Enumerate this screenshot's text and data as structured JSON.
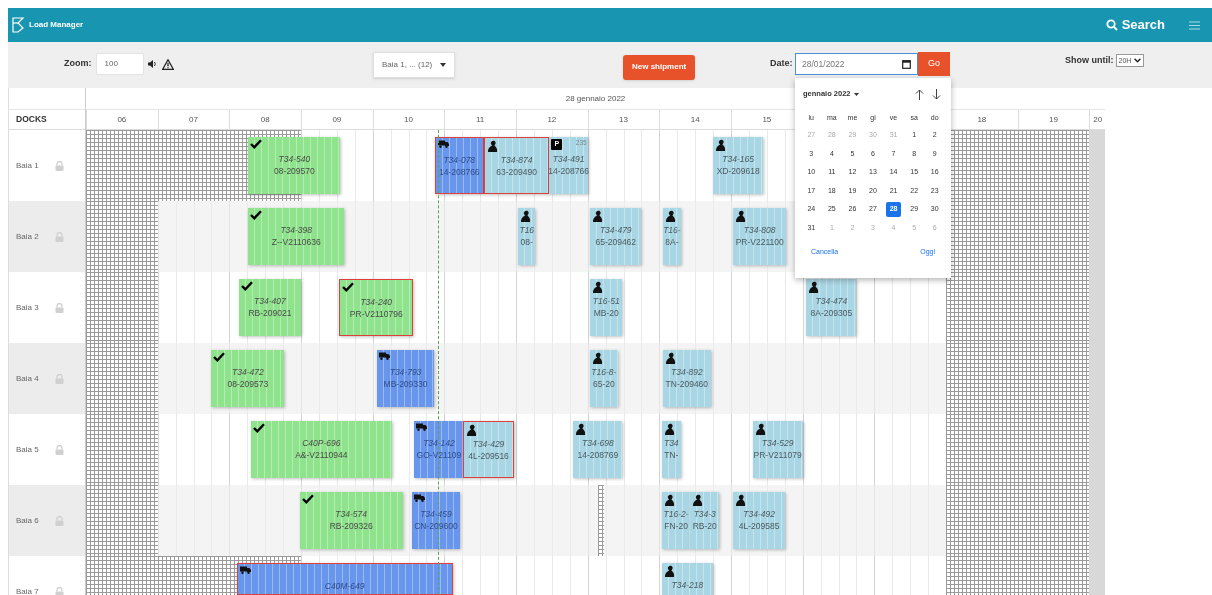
{
  "app": {
    "title": "Load Manager",
    "search": "Search"
  },
  "toolbar": {
    "zoom_label": "Zoom:",
    "zoom_value": "100",
    "dock_filter": "Baia 1, ... (12)",
    "new_shipment": "New shipment",
    "date_label": "Date:",
    "date_value": "28/01/2022",
    "go": "Go",
    "show_until_label": "Show until:",
    "show_until_value": "20H"
  },
  "calendar": {
    "month": "gennaio 2022",
    "weekdays": [
      "lu",
      "ma",
      "me",
      "gi",
      "ve",
      "sa",
      "do"
    ],
    "weeks": [
      [
        {
          "day": "27",
          "outside": true,
          "selected": false
        },
        {
          "day": "28",
          "outside": true,
          "selected": false
        },
        {
          "day": "29",
          "outside": true,
          "selected": false
        },
        {
          "day": "30",
          "outside": true,
          "selected": false
        },
        {
          "day": "31",
          "outside": true,
          "selected": false
        },
        {
          "day": "1",
          "outside": false,
          "selected": false
        },
        {
          "day": "2",
          "outside": false,
          "selected": false
        }
      ],
      [
        {
          "day": "3",
          "outside": false,
          "selected": false
        },
        {
          "day": "4",
          "outside": false,
          "selected": false
        },
        {
          "day": "5",
          "outside": false,
          "selected": false
        },
        {
          "day": "6",
          "outside": false,
          "selected": false
        },
        {
          "day": "7",
          "outside": false,
          "selected": false
        },
        {
          "day": "8",
          "outside": false,
          "selected": false
        },
        {
          "day": "9",
          "outside": false,
          "selected": false
        }
      ],
      [
        {
          "day": "10",
          "outside": false,
          "selected": false
        },
        {
          "day": "11",
          "outside": false,
          "selected": false
        },
        {
          "day": "12",
          "outside": false,
          "selected": false
        },
        {
          "day": "13",
          "outside": false,
          "selected": false
        },
        {
          "day": "14",
          "outside": false,
          "selected": false
        },
        {
          "day": "15",
          "outside": false,
          "selected": false
        },
        {
          "day": "16",
          "outside": false,
          "selected": false
        }
      ],
      [
        {
          "day": "17",
          "outside": false,
          "selected": false
        },
        {
          "day": "18",
          "outside": false,
          "selected": false
        },
        {
          "day": "19",
          "outside": false,
          "selected": false
        },
        {
          "day": "20",
          "outside": false,
          "selected": false
        },
        {
          "day": "21",
          "outside": false,
          "selected": false
        },
        {
          "day": "22",
          "outside": false,
          "selected": false
        },
        {
          "day": "23",
          "outside": false,
          "selected": false
        }
      ],
      [
        {
          "day": "24",
          "outside": false,
          "selected": false
        },
        {
          "day": "25",
          "outside": false,
          "selected": false
        },
        {
          "day": "26",
          "outside": false,
          "selected": false
        },
        {
          "day": "27",
          "outside": false,
          "selected": false
        },
        {
          "day": "28",
          "outside": false,
          "selected": true
        },
        {
          "day": "29",
          "outside": false,
          "selected": false
        },
        {
          "day": "30",
          "outside": false,
          "selected": false
        }
      ],
      [
        {
          "day": "31",
          "outside": false,
          "selected": false
        },
        {
          "day": "1",
          "outside": true,
          "selected": false
        },
        {
          "day": "2",
          "outside": true,
          "selected": false
        },
        {
          "day": "3",
          "outside": true,
          "selected": false
        },
        {
          "day": "4",
          "outside": true,
          "selected": false
        },
        {
          "day": "5",
          "outside": true,
          "selected": false
        },
        {
          "day": "6",
          "outside": true,
          "selected": false
        }
      ]
    ],
    "clear": "Cancella",
    "today": "Oggi"
  },
  "schedule": {
    "date": "28 gennaio 2022",
    "docks_label": "DOCKS",
    "hours": [
      "06",
      "07",
      "08",
      "09",
      "10",
      "11",
      "12",
      "13",
      "14",
      "15",
      "18",
      "19",
      "20"
    ],
    "docks": [
      {
        "name": "Baia 1",
        "shipments": [
          {
            "kind": "done",
            "late": false,
            "title": "T34-540",
            "code": "08-209570"
          },
          {
            "kind": "truck",
            "late": true,
            "title": "T34-078",
            "code": "14-208766"
          },
          {
            "kind": "sea",
            "late": true,
            "title": "T34-874",
            "code": "63-209490"
          },
          {
            "kind": "parked",
            "late": false,
            "title": "T34-491",
            "code": "14-208766",
            "badge": "P",
            "note": "235"
          },
          {
            "kind": "sea",
            "late": false,
            "title": "T34-165",
            "code": "XD-209618"
          }
        ]
      },
      {
        "name": "Baia 2",
        "shipments": [
          {
            "kind": "done",
            "late": false,
            "title": "T34-398",
            "code": "Z--V2110636"
          },
          {
            "kind": "sea",
            "late": false,
            "title": "T16",
            "code": "08-"
          },
          {
            "kind": "sea",
            "late": false,
            "title": "T34-479",
            "code": "65-209462"
          },
          {
            "kind": "sea",
            "late": false,
            "title": "T16-",
            "code": "8A-"
          },
          {
            "kind": "sea",
            "late": false,
            "title": "T34-808",
            "code": "PR-V221100"
          }
        ]
      },
      {
        "name": "Baia 3",
        "shipments": [
          {
            "kind": "done",
            "late": false,
            "title": "T34-407",
            "code": "RB-209021"
          },
          {
            "kind": "done",
            "late": true,
            "title": "T34-240",
            "code": "PR-V2110796"
          },
          {
            "kind": "sea",
            "late": false,
            "title": "T16-51",
            "code": "MB-20"
          },
          {
            "kind": "sea",
            "late": false,
            "title": "T34-474",
            "code": "8A-209305"
          }
        ]
      },
      {
        "name": "Baia 4",
        "shipments": [
          {
            "kind": "done",
            "late": false,
            "title": "T34-472",
            "code": "08-209573"
          },
          {
            "kind": "truck",
            "late": false,
            "title": "T34-793",
            "code": "MB-209330"
          },
          {
            "kind": "sea",
            "late": false,
            "title": "T16-8-",
            "code": "65-20"
          },
          {
            "kind": "sea",
            "late": false,
            "title": "T34-892",
            "code": "TN-209460"
          }
        ]
      },
      {
        "name": "Baia 5",
        "shipments": [
          {
            "kind": "done",
            "late": false,
            "title": "C40P-696",
            "code": "A&-V2110944"
          },
          {
            "kind": "truck",
            "late": false,
            "title": "T34-142",
            "code": "GO-V21109"
          },
          {
            "kind": "sea",
            "late": true,
            "title": "T34-429",
            "code": "4L-209516"
          },
          {
            "kind": "sea",
            "late": false,
            "title": "T34-698",
            "code": "14-208769"
          },
          {
            "kind": "sea",
            "late": false,
            "title": "T34",
            "code": "TN-"
          },
          {
            "kind": "sea",
            "late": false,
            "title": "T34-529",
            "code": "PR-V211079"
          }
        ]
      },
      {
        "name": "Baia 6",
        "shipments": [
          {
            "kind": "done",
            "late": false,
            "title": "T34-574",
            "code": "RB-209326"
          },
          {
            "kind": "truck",
            "late": false,
            "title": "T34-459",
            "code": "CN-209600"
          },
          {
            "kind": "sea",
            "late": false,
            "title": "T16-2-",
            "code": "FN-20"
          },
          {
            "kind": "sea",
            "late": false,
            "title": "T34-3",
            "code": "RB-20"
          },
          {
            "kind": "sea",
            "late": false,
            "title": "T34-492",
            "code": "4L-209585"
          }
        ]
      },
      {
        "name": "Baia 7",
        "shipments": [
          {
            "kind": "truck",
            "late": true,
            "title": "C40M-649"
          },
          {
            "kind": "sea",
            "late": false,
            "title": "T34-218"
          }
        ]
      }
    ]
  }
}
